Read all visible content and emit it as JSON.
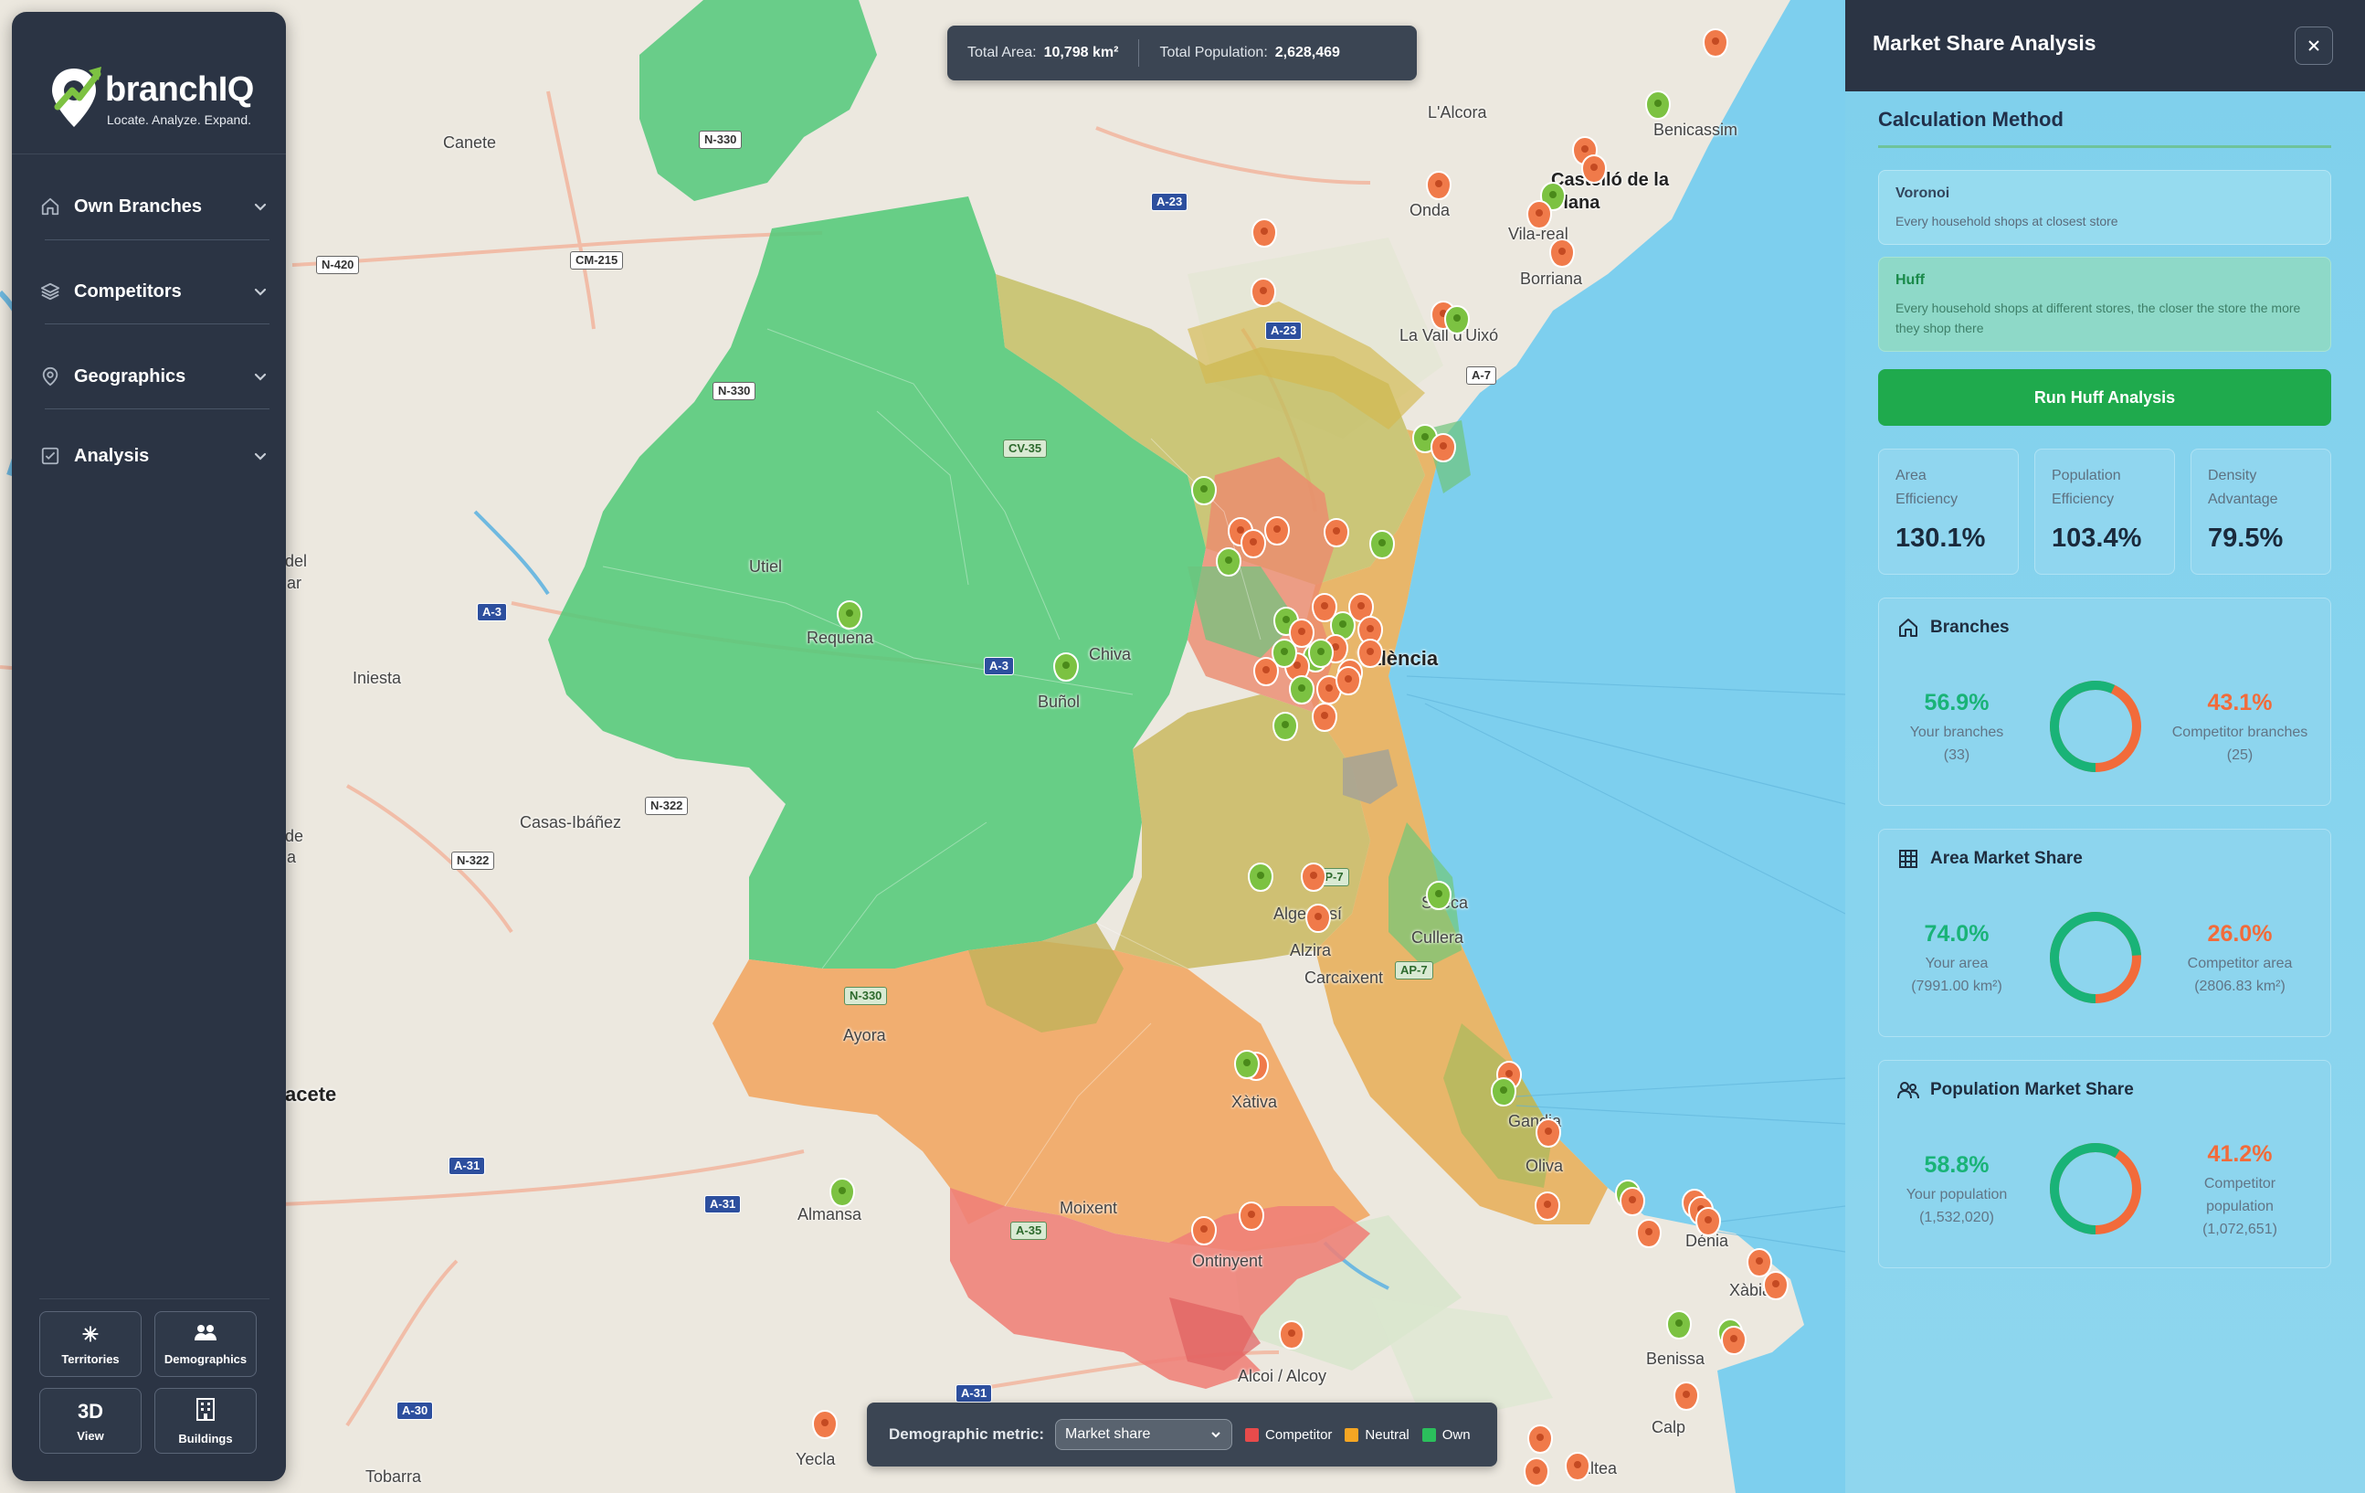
{
  "app": {
    "name": "branchIQ",
    "tagline": "Locate. Analyze. Expand."
  },
  "sidebar": {
    "items": [
      {
        "label": "Own Branches",
        "icon": "home-icon"
      },
      {
        "label": "Competitors",
        "icon": "layers-icon"
      },
      {
        "label": "Geographics",
        "icon": "map-pin-icon"
      },
      {
        "label": "Analysis",
        "icon": "checklist-icon"
      }
    ],
    "tools": [
      {
        "label": "Territories",
        "icon": "territories-icon"
      },
      {
        "label": "Demographics",
        "icon": "people-icon"
      },
      {
        "label": "View",
        "badge": "3D",
        "icon": "cube-icon"
      },
      {
        "label": "Buildings",
        "icon": "building-icon"
      }
    ]
  },
  "stats": {
    "area_label": "Total Area:",
    "area_value": "10,798 km²",
    "pop_label": "Total Population:",
    "pop_value": "2,628,469"
  },
  "legend": {
    "metric_label": "Demographic metric:",
    "metric_value": "Market share",
    "items": [
      {
        "label": "Competitor",
        "color": "#e84b4b"
      },
      {
        "label": "Neutral",
        "color": "#f5a623"
      },
      {
        "label": "Own",
        "color": "#2bbf5c"
      }
    ]
  },
  "panel": {
    "title": "Market Share Analysis",
    "calc_title": "Calculation Method",
    "methods": [
      {
        "name": "Voronoi",
        "desc": "Every household shops at closest store"
      },
      {
        "name": "Huff",
        "desc": "Every household shops at different stores, the closer the store the more they shop there"
      }
    ],
    "run_label": "Run Huff Analysis",
    "metrics": [
      {
        "label1": "Area",
        "label2": "Efficiency",
        "value": "130.1%"
      },
      {
        "label1": "Population",
        "label2": "Efficiency",
        "value": "103.4%"
      },
      {
        "label1": "Density",
        "label2": "Advantage",
        "value": "79.5%"
      }
    ],
    "branches": {
      "title": "Branches",
      "own_value": "56.9%",
      "own_label": "Your branches",
      "own_sub": "(33)",
      "comp_value": "43.1%",
      "comp_label": "Competitor branches",
      "comp_sub": "(25)",
      "own_fraction": 0.569
    },
    "area_share": {
      "title": "Area Market Share",
      "own_value": "74.0%",
      "own_label": "Your area",
      "own_sub": "(7991.00 km²)",
      "comp_value": "26.0%",
      "comp_label": "Competitor area",
      "comp_sub": "(2806.83 km²)",
      "own_fraction": 0.74
    },
    "pop_share": {
      "title": "Population Market Share",
      "own_value": "58.8%",
      "own_label": "Your population",
      "own_sub": "(1,532,020)",
      "comp_value": "41.2%",
      "comp_label": "Competitor",
      "comp_label2": "population",
      "comp_sub": "(1,072,651)",
      "own_fraction": 0.588
    },
    "colors": {
      "own": "#19b377",
      "competitor": "#f26b3a"
    }
  },
  "map": {
    "towns": [
      "Benicassim",
      "L'Alcora",
      "Castelló de la Plana",
      "Onda",
      "Vila-real",
      "Borriana",
      "La Vall d'Uixó",
      "Canete",
      "Requena",
      "Buñol",
      "Chiva",
      "Iniesta",
      "Casas-Ibáñez",
      "Ayora",
      "Almansa",
      "Alzira",
      "Alcoi / Alcoy",
      "Ontinyent",
      "Xàtiva",
      "Gandia",
      "Oliva",
      "Dénia",
      "Xàbia",
      "Benissa",
      "Calp",
      "Altea",
      "Yecla",
      "Tobarra",
      "Cullera",
      "Sueca",
      "Carcaixent",
      "Algemesí",
      "Moixent",
      "València",
      "del",
      "ar",
      "de",
      "a",
      "acete",
      "Utiel"
    ],
    "roads": [
      "N-330",
      "A-23",
      "N-420",
      "CM-215",
      "N-330",
      "CV-35",
      "A-3",
      "A-3",
      "A-7",
      "N-322",
      "N-322",
      "N-330",
      "A-31",
      "A-31",
      "A-35",
      "A-31",
      "A-30",
      "AP-7",
      "AP-7",
      "A-23"
    ]
  }
}
